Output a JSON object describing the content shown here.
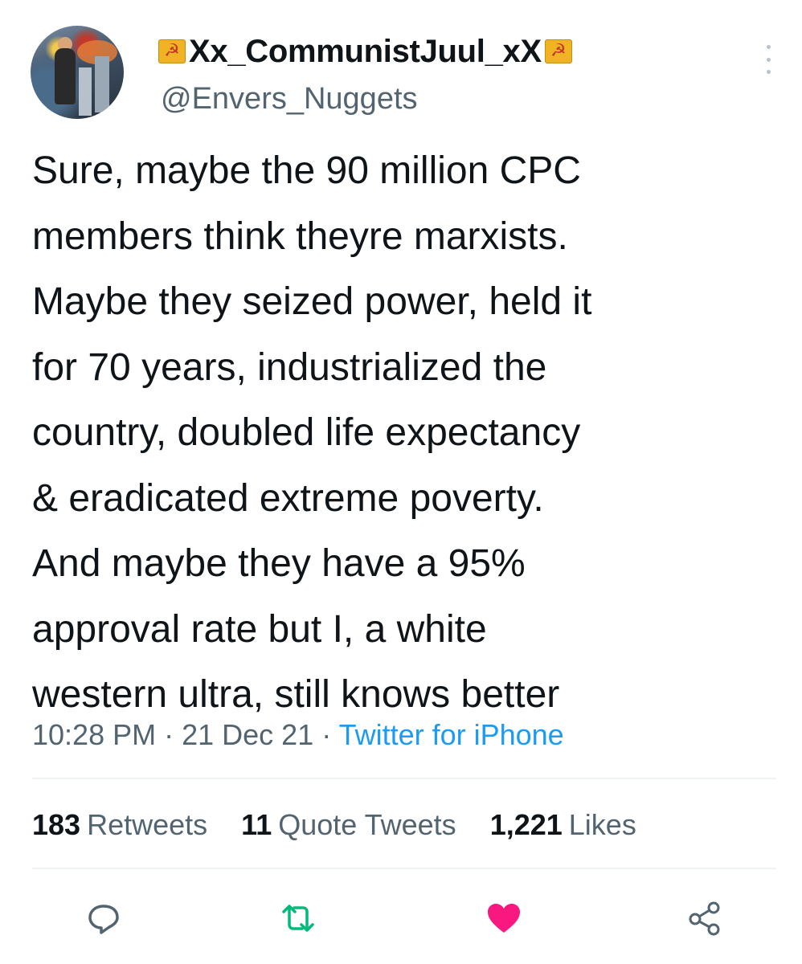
{
  "user": {
    "display_name": "Xx_CommunistJuul_xX",
    "handle": "@Envers_Nuggets",
    "name_flag_icons": [
      "hammer-sickle-flag-icon",
      "hammer-sickle-flag-icon"
    ]
  },
  "tweet": {
    "lines": [
      "Sure, maybe the 90 million CPC",
      "members think theyre marxists.",
      "Maybe they seized power, held it",
      "for 70 years, industrialized the",
      "country, doubled life expectancy",
      "& eradicated extreme poverty.",
      "And maybe they have a 95%",
      "approval rate but I, a white",
      "western ultra, still knows better"
    ],
    "time": "10:28 PM",
    "date": "21 Dec 21",
    "separator": "·",
    "source": "Twitter for iPhone"
  },
  "stats": {
    "retweets": {
      "count": "183",
      "label": "Retweets"
    },
    "quote_tweets": {
      "count": "11",
      "label": "Quote Tweets"
    },
    "likes": {
      "count": "1,221",
      "label": "Likes"
    }
  },
  "actions": {
    "icons": [
      "reply-icon",
      "retweet-icon",
      "like-icon",
      "share-icon"
    ]
  },
  "colors": {
    "text": "#0f1419",
    "secondary": "#536471",
    "link": "#1d9bf0",
    "retweet_green": "#00ba7c",
    "like_pink": "#f91880",
    "divider": "#eff3f4"
  }
}
